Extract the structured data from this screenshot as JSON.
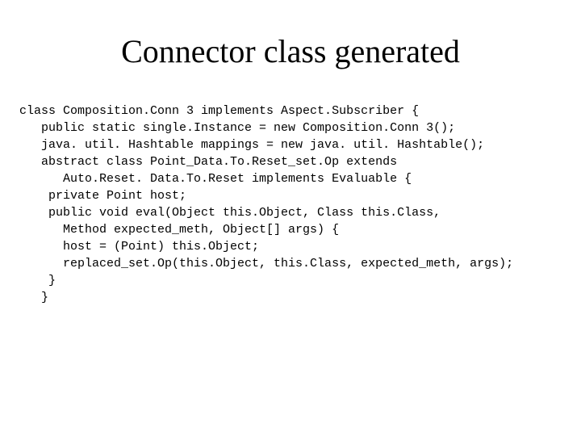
{
  "title": "Connector class generated",
  "code_lines": [
    "class Composition.Conn 3 implements Aspect.Subscriber {",
    "   public static single.Instance = new Composition.Conn 3();",
    "   java. util. Hashtable mappings = new java. util. Hashtable();",
    "   abstract class Point_Data.To.Reset_set.Op extends",
    "      Auto.Reset. Data.To.Reset implements Evaluable {",
    "    private Point host;",
    "    public void eval(Object this.Object, Class this.Class,",
    "      Method expected_meth, Object[] args) {",
    "      host = (Point) this.Object;",
    "      replaced_set.Op(this.Object, this.Class, expected_meth, args);",
    "    }",
    "   }"
  ]
}
